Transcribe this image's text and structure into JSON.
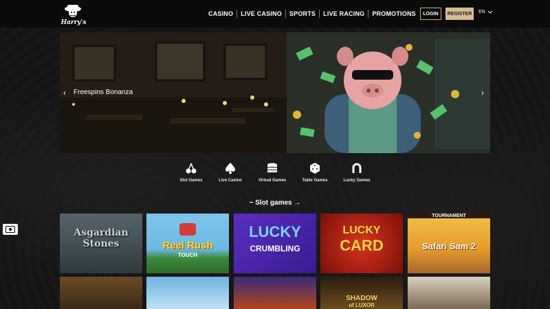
{
  "brand": {
    "logo_text": "Harry's"
  },
  "nav": {
    "items": [
      "CASINO",
      "LIVE CASINO",
      "SPORTS",
      "LIVE RACING",
      "PROMOTIONS"
    ],
    "login": "LOGIN",
    "register": "REGISTER",
    "language": "EN"
  },
  "hero": {
    "title": "Freespins Bonanza"
  },
  "categories": [
    "Slot Games",
    "Live Casino",
    "Virtual Games",
    "Table Games",
    "Lucky Games"
  ],
  "section": {
    "title": "Slot games"
  },
  "games": {
    "row1": [
      {
        "name": "Asgardian Stones"
      },
      {
        "name": "Reel Rush",
        "sub": "TOUCH"
      },
      {
        "name": "LUCKY",
        "sub": "CRUMBLING"
      },
      {
        "name": "LUCKY",
        "sub": "CARD"
      },
      {
        "name": "Safari Sam 2",
        "banner": "TOURNAMENT"
      }
    ],
    "row2": [
      {
        "name": ""
      },
      {
        "name": ""
      },
      {
        "name": ""
      },
      {
        "name": "SHADOW",
        "sub": "of LUXOR"
      },
      {
        "name": ""
      }
    ]
  },
  "colors": {
    "accent": "#d7bc93",
    "header_bg": "#0b0b0b",
    "page_bg": "#141414"
  }
}
